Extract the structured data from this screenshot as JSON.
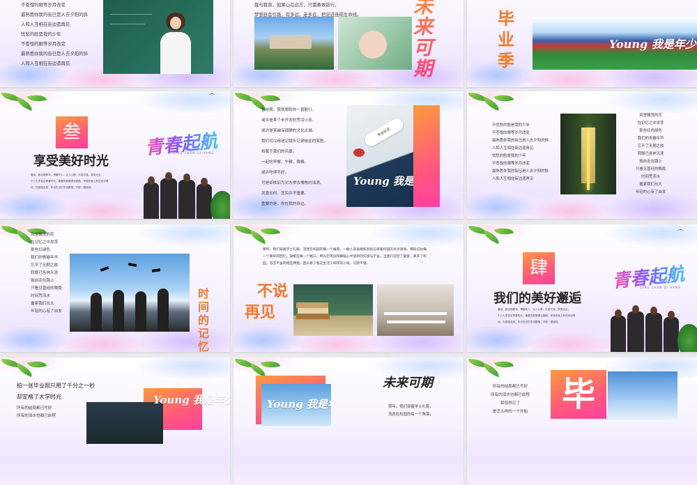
{
  "slides": {
    "s1": {
      "lines": [
        "不苍惶的眼等岁月改变",
        "最熟悉你我的街已是人去夕阳的斜",
        "人和人互相在街边遗再见",
        "忧愁的脸是我的少年",
        "不苍惶的眼等岁月改变",
        "最熟悉你我的街已是人去夕阳的斜",
        "人和人互相在街边遗再见"
      ]
    },
    "s2": {
      "lines": [
        "我与我曾，如果心在远方，只需勇敢前行，",
        "梦想自会引路，有多远，走多远，把足迹连成生命线。"
      ],
      "art_title": "未来可期"
    },
    "s3": {
      "title": "毕业季",
      "script": "Young 我是年少"
    },
    "s4": {
      "badge": "叁",
      "title": "享受美好时光",
      "desc": [
        "曾经，都记得那年，青春年少，认人心醉，天真烂漫，笑笑点点，",
        "十八七岁初见青春时代，喜着的美丽哪也绝配，年轻的我上有些未识得",
        "自，在碰碰走成，年月在记忆年流露落，不能一直保持。"
      ],
      "neon": "青春起航",
      "neon_sub": "QING CHUN QI HANG"
    },
    "s5": {
      "lines": [
        "曾经我，我我想和你一直散行，",
        "或许是某个未开发的荒凉小岛，",
        "或许是某幽深孤静的文化古城。",
        "我们可以用途记镜头记录彼此的笑脸，",
        "和属于我们的风景。",
        "一起吃早餐，午餐，晚餐。",
        "或许吃得不好。",
        "可是却依旧为对方惨去嘴角的油渍。",
        "风景如何，其实并不重要。",
        "重要的是，你在我的身边。"
      ],
      "scroll_text": "毕业纪念",
      "script": "Young 我是年少"
    },
    "s6": {
      "left": [
        "不忧愁的脸是我的少年",
        "不苍惶的眼等岁月改变",
        "最熟悉你我的街已是人去夕阳的斜",
        "人和人互相在街边遗再见",
        "忧愁的脸是我的少年",
        "不苍惶的眼等岁月改变",
        "最熟悉你我的街已是人去夕阳的斜",
        "人和人互相在街边遗再见"
      ],
      "right": [
        "风里飘荡的花",
        "在记忆之中发芽",
        "那些红色绿色",
        "我们的青春年华",
        "忘不了无期之旅",
        "转眼已各奔天涯",
        "独自走在路上",
        "只看见曾经的晚霞",
        "时间荒流水",
        "握紧我们长大",
        "年轻的心有了自发"
      ]
    },
    "s7": {
      "lines": [
        "风里飘荡的花",
        "在记忆之中发芽",
        "那些红绿色",
        "我们的青春年华",
        "忘不了无期之旅",
        "转眼已各奔天涯",
        "独自走在路上",
        "只看见曾经的晚霞",
        "时间荒流水",
        "握紧我们长大",
        "年轻的心有了自发"
      ],
      "side_title": "时间的记忆"
    },
    "s8": {
      "para": [
        "那年，我们穿着学士礼服，流连在校园的每一个角落，一群人拿着相机到处记录着校园的点点滴滴，那段记住每",
        "一个美好的回忆，穿梭在每一个路口，用光芒笑谈和舞蹈心中逐新的伤感与不舍，当我们流空了最宽，离开了校",
        "园，恋恋不舍的相互拥抱，回头看了看这生活了四年的小窝，沉默不语。"
      ],
      "title_a": "不说",
      "title_b": "再见"
    },
    "s9": {
      "badge": "肆",
      "title": "我们的美好邂逅",
      "desc": [
        "曾经，都记得那年，青春年少，认人心醉，天真烂漫，笑笑点点，",
        "十八七岁初见青春时代，喜着的美丽哪也绝配，年轻的我上有些未识得",
        "自，在碰碰走成，年月在记忆年流露落，不能一直保持。"
      ],
      "neon": "青春起航",
      "neon_sub": "QING CHUN QI HANG"
    },
    "s10": {
      "head_a": "拍一张毕业照只用了千分之一秒",
      "head_b": "却定格了大学时光",
      "lines": [
        "所有的结局都已写好",
        "所有的泪水也都已启程"
      ],
      "script": "Young 我是年少"
    },
    "s11": {
      "art_title": "未来可期",
      "lines": [
        "那年，我们穿着学士礼服，",
        "流连在校园的每一个角落，"
      ],
      "script": "Young 我是年少"
    },
    "s12": {
      "lines": [
        "所有的结局都已写好",
        "所有的泪水也都已启程",
        "却忽然忘了",
        "是怎么样的一个开始"
      ],
      "big": "毕"
    }
  },
  "colors": {
    "accent_orange": "#f07a2a",
    "accent_pink": "#ff4f9a",
    "bg": "#e9e9ee"
  }
}
